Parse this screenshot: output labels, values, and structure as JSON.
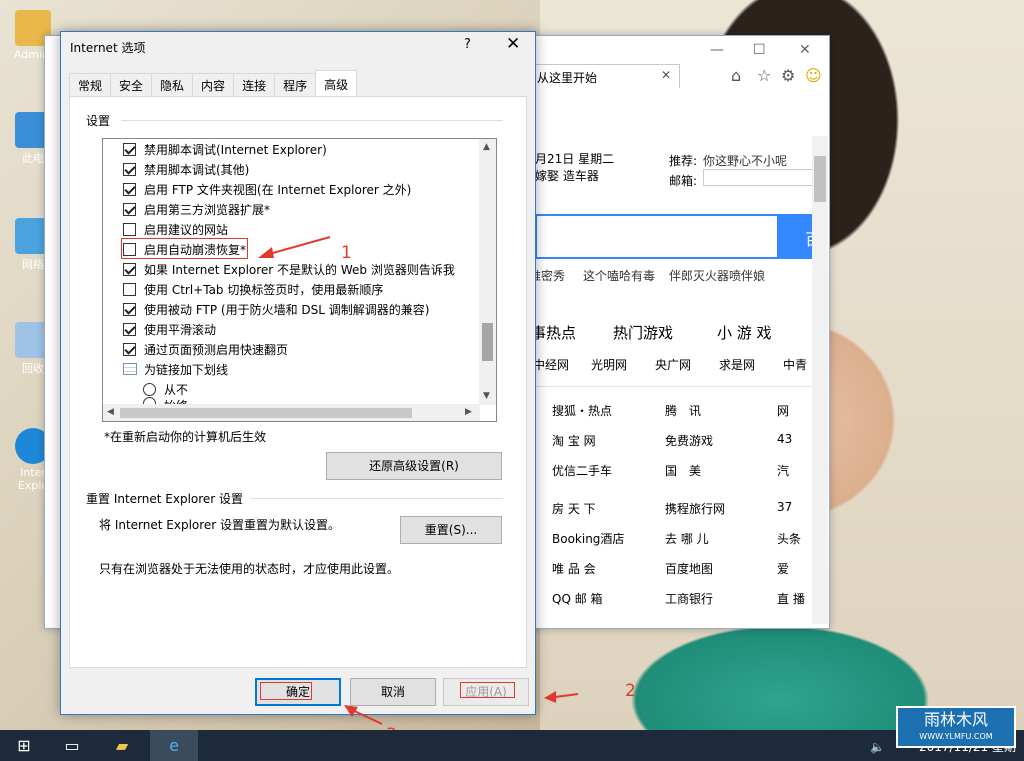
{
  "desktop": {
    "icons": [
      {
        "label": "Admini"
      },
      {
        "label": "此电"
      },
      {
        "label": "网络"
      },
      {
        "label": "回收"
      },
      {
        "label": "Inter Explo"
      }
    ]
  },
  "browser": {
    "tab_label": "从这里开始",
    "date_text": "月21日  星期二",
    "sub_text": "嫁娶  造车器",
    "recommend_label": "推荐:",
    "recommend_text": "你这野心不小呢",
    "mailbox_label": "邮箱:",
    "search_btn": "百",
    "hot_links": [
      "推密秀",
      "这个嗑哈有毒",
      "伴郎灭火器喷伴娘"
    ],
    "category_tabs": [
      "事热点",
      "热门游戏",
      "小 游 戏"
    ],
    "news_links": [
      "中经网",
      "光明网",
      "央广网",
      "求是网",
      "中青"
    ],
    "sites": [
      [
        "搜狐・热点",
        "腾　讯",
        "网"
      ],
      [
        "淘 宝 网",
        "免费游戏",
        "43"
      ],
      [
        "优信二手车",
        "国　美",
        "汽"
      ],
      [
        "房 天 下",
        "携程旅行网",
        "37"
      ],
      [
        "Booking酒店",
        "去 哪 儿",
        "头条"
      ],
      [
        "唯 品 会",
        "百度地图",
        "爱"
      ],
      [
        "QQ 邮 箱",
        "工商银行",
        "直 播"
      ]
    ]
  },
  "dialog": {
    "title": "Internet 选项",
    "help": "?",
    "close": "✕",
    "tabs": [
      "常规",
      "安全",
      "隐私",
      "内容",
      "连接",
      "程序",
      "高级"
    ],
    "active_tab": "高级",
    "settings_label": "设置",
    "settings": [
      {
        "label": "禁用脚本调试(Internet Explorer)",
        "checked": true
      },
      {
        "label": "禁用脚本调试(其他)",
        "checked": true
      },
      {
        "label": "启用 FTP 文件夹视图(在 Internet Explorer 之外)",
        "checked": true
      },
      {
        "label": "启用第三方浏览器扩展*",
        "checked": true
      },
      {
        "label": "启用建议的网站",
        "checked": false
      },
      {
        "label": "启用自动崩溃恢复*",
        "checked": false
      },
      {
        "label": "如果 Internet Explorer 不是默认的 Web 浏览器则告诉我",
        "checked": true
      },
      {
        "label": "使用 Ctrl+Tab 切换标签页时，使用最新顺序",
        "checked": false
      },
      {
        "label": "使用被动 FTP (用于防火墙和 DSL 调制解调器的兼容)",
        "checked": true
      },
      {
        "label": "使用平滑滚动",
        "checked": true
      },
      {
        "label": "通过页面预测启用快速翻页",
        "checked": true
      }
    ],
    "underline_group": "为链接加下划线",
    "underline_opt1": "从不",
    "underline_opt2": "始终",
    "restart_note": "*在重新启动你的计算机后生效",
    "restore_btn": "还原高级设置(R)",
    "reset_group": "重置 Internet Explorer 设置",
    "reset_desc": "将 Internet Explorer 设置重置为默认设置。",
    "reset_btn": "重置(S)...",
    "reset_note": "只有在浏览器处于无法使用的状态时，才应使用此设置。",
    "ok_btn": "确定",
    "cancel_btn": "取消",
    "apply_btn": "应用(A)"
  },
  "annotations": {
    "n1": "1",
    "n2": "2",
    "n3": "3"
  },
  "taskbar": {
    "clock": "2017/11/21 星期"
  },
  "watermark": {
    "title": "雨林木风",
    "url": "WWW.YLMFU.COM"
  },
  "colors": {
    "accent": "#0078d7",
    "annotation": "#e03a2e",
    "taskbar": "#1c2a3c"
  }
}
